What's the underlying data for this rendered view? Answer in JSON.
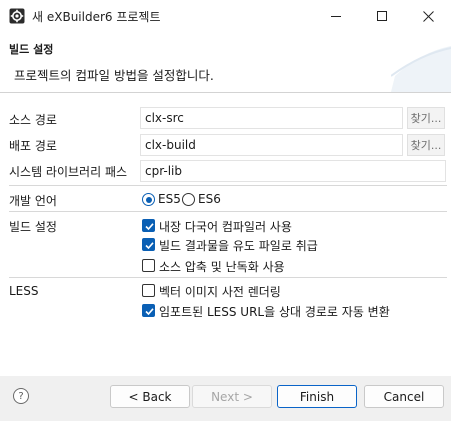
{
  "window": {
    "title": "새 eXBuilder6 프로젝트",
    "icon": "gear-icon",
    "controls": {
      "minimize": "minimize-icon",
      "maximize": "maximize-icon",
      "close": "close-icon"
    }
  },
  "header": {
    "title": "빌드 설정",
    "description": "프로젝트의 컴파일 방법을 설정합니다."
  },
  "form": {
    "source_path": {
      "label": "소스 경로",
      "value": "clx-src",
      "browse": "찾기..."
    },
    "deploy_path": {
      "label": "배포 경로",
      "value": "clx-build",
      "browse": "찾기..."
    },
    "system_library_path": {
      "label": "시스템 라이브러리 패스",
      "value": "cpr-lib"
    },
    "dev_language": {
      "label": "개발 언어",
      "options": [
        {
          "label": "ES5",
          "selected": true
        },
        {
          "label": "ES6",
          "selected": false
        }
      ]
    },
    "build_settings": {
      "label": "빌드 설정",
      "options": [
        {
          "label": "내장 다국어 컴파일러 사용",
          "checked": true
        },
        {
          "label": "빌드 결과물을 유도 파일로 취급",
          "checked": true
        },
        {
          "label": "소스 압축 및 난독화 사용",
          "checked": false
        }
      ]
    },
    "less": {
      "label": "LESS",
      "options": [
        {
          "label": "벡터 이미지 사전 렌더링",
          "checked": false
        },
        {
          "label": "임포트된 LESS URL을 상대 경로로 자동 변환",
          "checked": true
        }
      ]
    }
  },
  "footer": {
    "help": "?",
    "back": "< Back",
    "next": "Next >",
    "finish": "Finish",
    "cancel": "Cancel"
  },
  "colors": {
    "accent": "#0a5fb4",
    "background": "#f0f0f0",
    "panel": "#ffffff"
  }
}
